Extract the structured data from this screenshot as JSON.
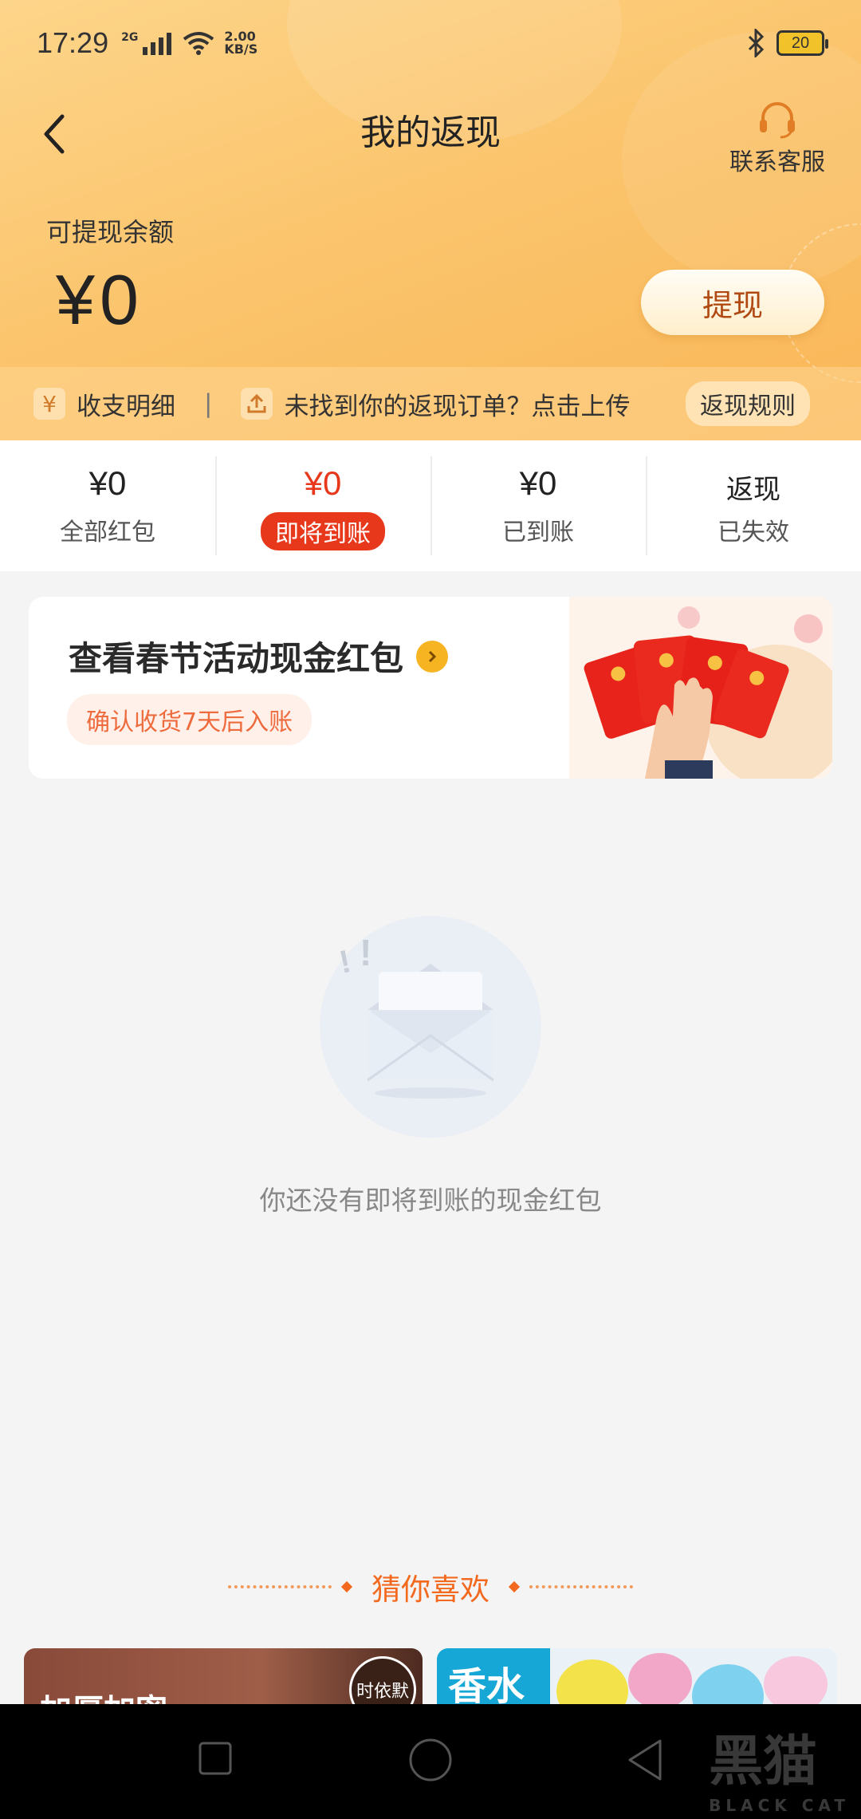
{
  "status_bar": {
    "time": "17:29",
    "network_type": "2G",
    "speed_value": "2.00",
    "speed_unit": "KB/S",
    "battery": "20"
  },
  "nav": {
    "title": "我的返现",
    "service_label": "联系客服"
  },
  "balance": {
    "label": "可提现余额",
    "amount": "¥0",
    "withdraw_label": "提现"
  },
  "info_bar": {
    "detail_icon": "¥",
    "detail_label": "收支明细",
    "separator": "|",
    "upload_text": "未找到你的返现订单？点击上传",
    "rules_label": "返现规则"
  },
  "tabs": [
    {
      "amount": "¥0",
      "label": "全部红包",
      "active": false
    },
    {
      "amount": "¥0",
      "label": "即将到账",
      "active": true
    },
    {
      "amount": "¥0",
      "label": "已到账",
      "active": false
    },
    {
      "amount": "返现",
      "label": "已失效",
      "active": false
    }
  ],
  "promo": {
    "title": "查看春节活动现金红包",
    "subtitle": "确认收货7天后入账"
  },
  "empty_state": {
    "message": "你还没有即将到账的现金红包"
  },
  "recommend": {
    "title": "猜你喜欢",
    "left_card_text": "加厚加密",
    "left_card_logo": "时依默",
    "right_card_tag": "香水"
  },
  "watermark": {
    "text": "黑猫",
    "sub": "BLACK CAT"
  },
  "colors": {
    "accent_red": "#e8381b",
    "header_orange": "#fbc56e",
    "recommend_orange": "#f36a1f"
  }
}
